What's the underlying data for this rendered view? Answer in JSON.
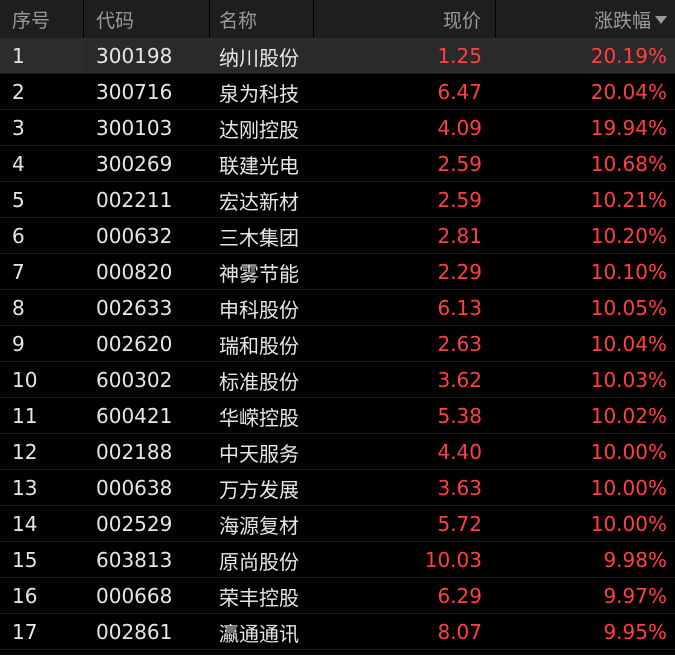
{
  "header": {
    "index": "序号",
    "code": "代码",
    "name": "名称",
    "price": "现价",
    "change_pct": "涨跌幅"
  },
  "colors": {
    "background": "#000000",
    "header_bg": "#1e1e1e",
    "header_text": "#9a9a9a",
    "text": "#e6e6e6",
    "up": "#ff4040",
    "selected_row": "#2a2a2a"
  },
  "sort": {
    "column": "change_pct",
    "direction": "desc",
    "icon": "sort-desc-icon"
  },
  "rows": [
    {
      "index": "1",
      "code": "300198",
      "name": "纳川股份",
      "price": "1.25",
      "change_pct": "20.19%"
    },
    {
      "index": "2",
      "code": "300716",
      "name": "泉为科技",
      "price": "6.47",
      "change_pct": "20.04%"
    },
    {
      "index": "3",
      "code": "300103",
      "name": "达刚控股",
      "price": "4.09",
      "change_pct": "19.94%"
    },
    {
      "index": "4",
      "code": "300269",
      "name": "联建光电",
      "price": "2.59",
      "change_pct": "10.68%"
    },
    {
      "index": "5",
      "code": "002211",
      "name": "宏达新材",
      "price": "2.59",
      "change_pct": "10.21%"
    },
    {
      "index": "6",
      "code": "000632",
      "name": "三木集团",
      "price": "2.81",
      "change_pct": "10.20%"
    },
    {
      "index": "7",
      "code": "000820",
      "name": "神雾节能",
      "price": "2.29",
      "change_pct": "10.10%"
    },
    {
      "index": "8",
      "code": "002633",
      "name": "申科股份",
      "price": "6.13",
      "change_pct": "10.05%"
    },
    {
      "index": "9",
      "code": "002620",
      "name": "瑞和股份",
      "price": "2.63",
      "change_pct": "10.04%"
    },
    {
      "index": "10",
      "code": "600302",
      "name": "标准股份",
      "price": "3.62",
      "change_pct": "10.03%"
    },
    {
      "index": "11",
      "code": "600421",
      "name": "华嵘控股",
      "price": "5.38",
      "change_pct": "10.02%"
    },
    {
      "index": "12",
      "code": "002188",
      "name": "中天服务",
      "price": "4.40",
      "change_pct": "10.00%"
    },
    {
      "index": "13",
      "code": "000638",
      "name": "万方发展",
      "price": "3.63",
      "change_pct": "10.00%"
    },
    {
      "index": "14",
      "code": "002529",
      "name": "海源复材",
      "price": "5.72",
      "change_pct": "10.00%"
    },
    {
      "index": "15",
      "code": "603813",
      "name": "原尚股份",
      "price": "10.03",
      "change_pct": "9.98%"
    },
    {
      "index": "16",
      "code": "000668",
      "name": "荣丰控股",
      "price": "6.29",
      "change_pct": "9.97%"
    },
    {
      "index": "17",
      "code": "002861",
      "name": "瀛通通讯",
      "price": "8.07",
      "change_pct": "9.95%"
    }
  ]
}
